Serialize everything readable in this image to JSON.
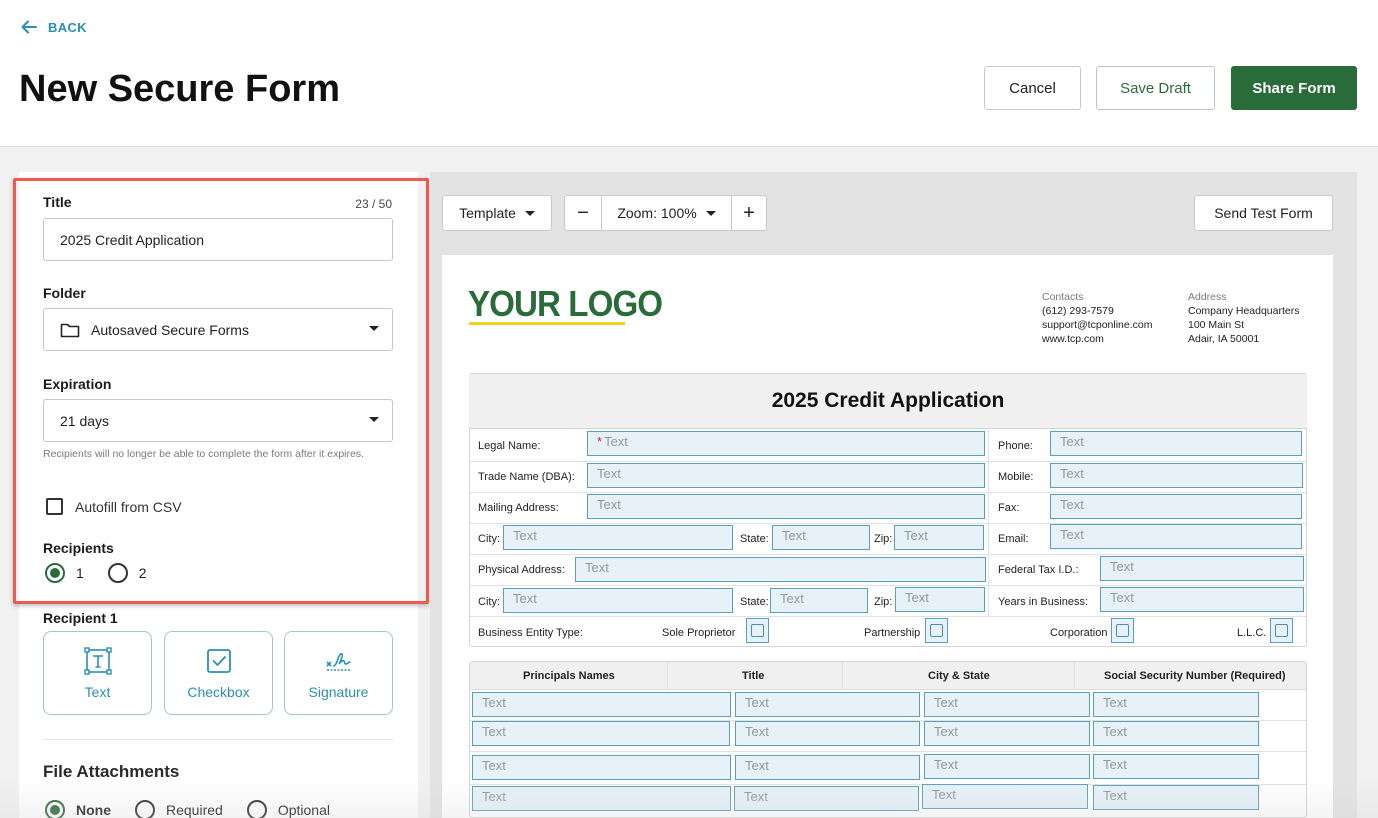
{
  "header": {
    "back_label": "BACK",
    "page_title": "New Secure Form",
    "cancel_label": "Cancel",
    "save_draft_label": "Save Draft",
    "share_form_label": "Share Form"
  },
  "sidebar": {
    "title_label": "Title",
    "title_counter": "23 / 50",
    "title_value": "2025 Credit Application",
    "folder_label": "Folder",
    "folder_value": "Autosaved Secure Forms",
    "expiration_label": "Expiration",
    "expiration_value": "21 days",
    "expiration_help": "Recipients will no longer be able to complete the form after it expires.",
    "autofill_label": "Autofill from CSV",
    "recipients_label": "Recipients",
    "recipients_options": [
      "1",
      "2"
    ],
    "recipients_selected": "1",
    "recipient1_label": "Recipient 1",
    "tools": [
      "Text",
      "Checkbox",
      "Signature"
    ],
    "file_attachments_label": "File Attachments",
    "file_attachment_options": [
      "None",
      "Required",
      "Optional"
    ],
    "file_attachment_selected": "None"
  },
  "toolbar": {
    "template_label": "Template",
    "zoom_label": "Zoom: 100%",
    "zoom_out": "−",
    "zoom_in": "+",
    "send_test_label": "Send Test Form"
  },
  "document": {
    "logo_text": "YOUR LOGO",
    "contacts_heading": "Contacts",
    "contacts_lines": [
      "(612) 293-7579",
      "support@tcponline.com",
      "www.tcp.com"
    ],
    "address_heading": "Address",
    "address_lines": [
      "Company Headquarters",
      "100 Main St",
      "Adair, IA 50001"
    ],
    "form_title": "2025 Credit Application",
    "placeholder": "Text",
    "labels": {
      "legal_name": "Legal Name:",
      "trade_name": "Trade Name (DBA):",
      "mailing_address": "Mailing Address:",
      "city": "City:",
      "state": "State:",
      "zip": "Zip:",
      "physical_address": "Physical Address:",
      "phone": "Phone:",
      "mobile": "Mobile:",
      "fax": "Fax:",
      "email": "Email:",
      "federal_tax_id": "Federal Tax I.D.:",
      "years_in_business": "Years in Business:",
      "business_entity_type": "Business Entity Type:",
      "sole_proprietor": "Sole Proprietor",
      "partnership": "Partnership",
      "corporation": "Corporation",
      "llc": "L.L.C."
    },
    "principals_headers": [
      "Principals Names",
      "Title",
      "City & State",
      "Social Security Number (Required)"
    ]
  },
  "colors": {
    "brand_green": "#2a6b3a",
    "link_blue": "#2a8fb6",
    "highlight_red": "#ef5a50",
    "field_fill": "#e6f1f8",
    "logo_underline": "#f2d11f"
  }
}
